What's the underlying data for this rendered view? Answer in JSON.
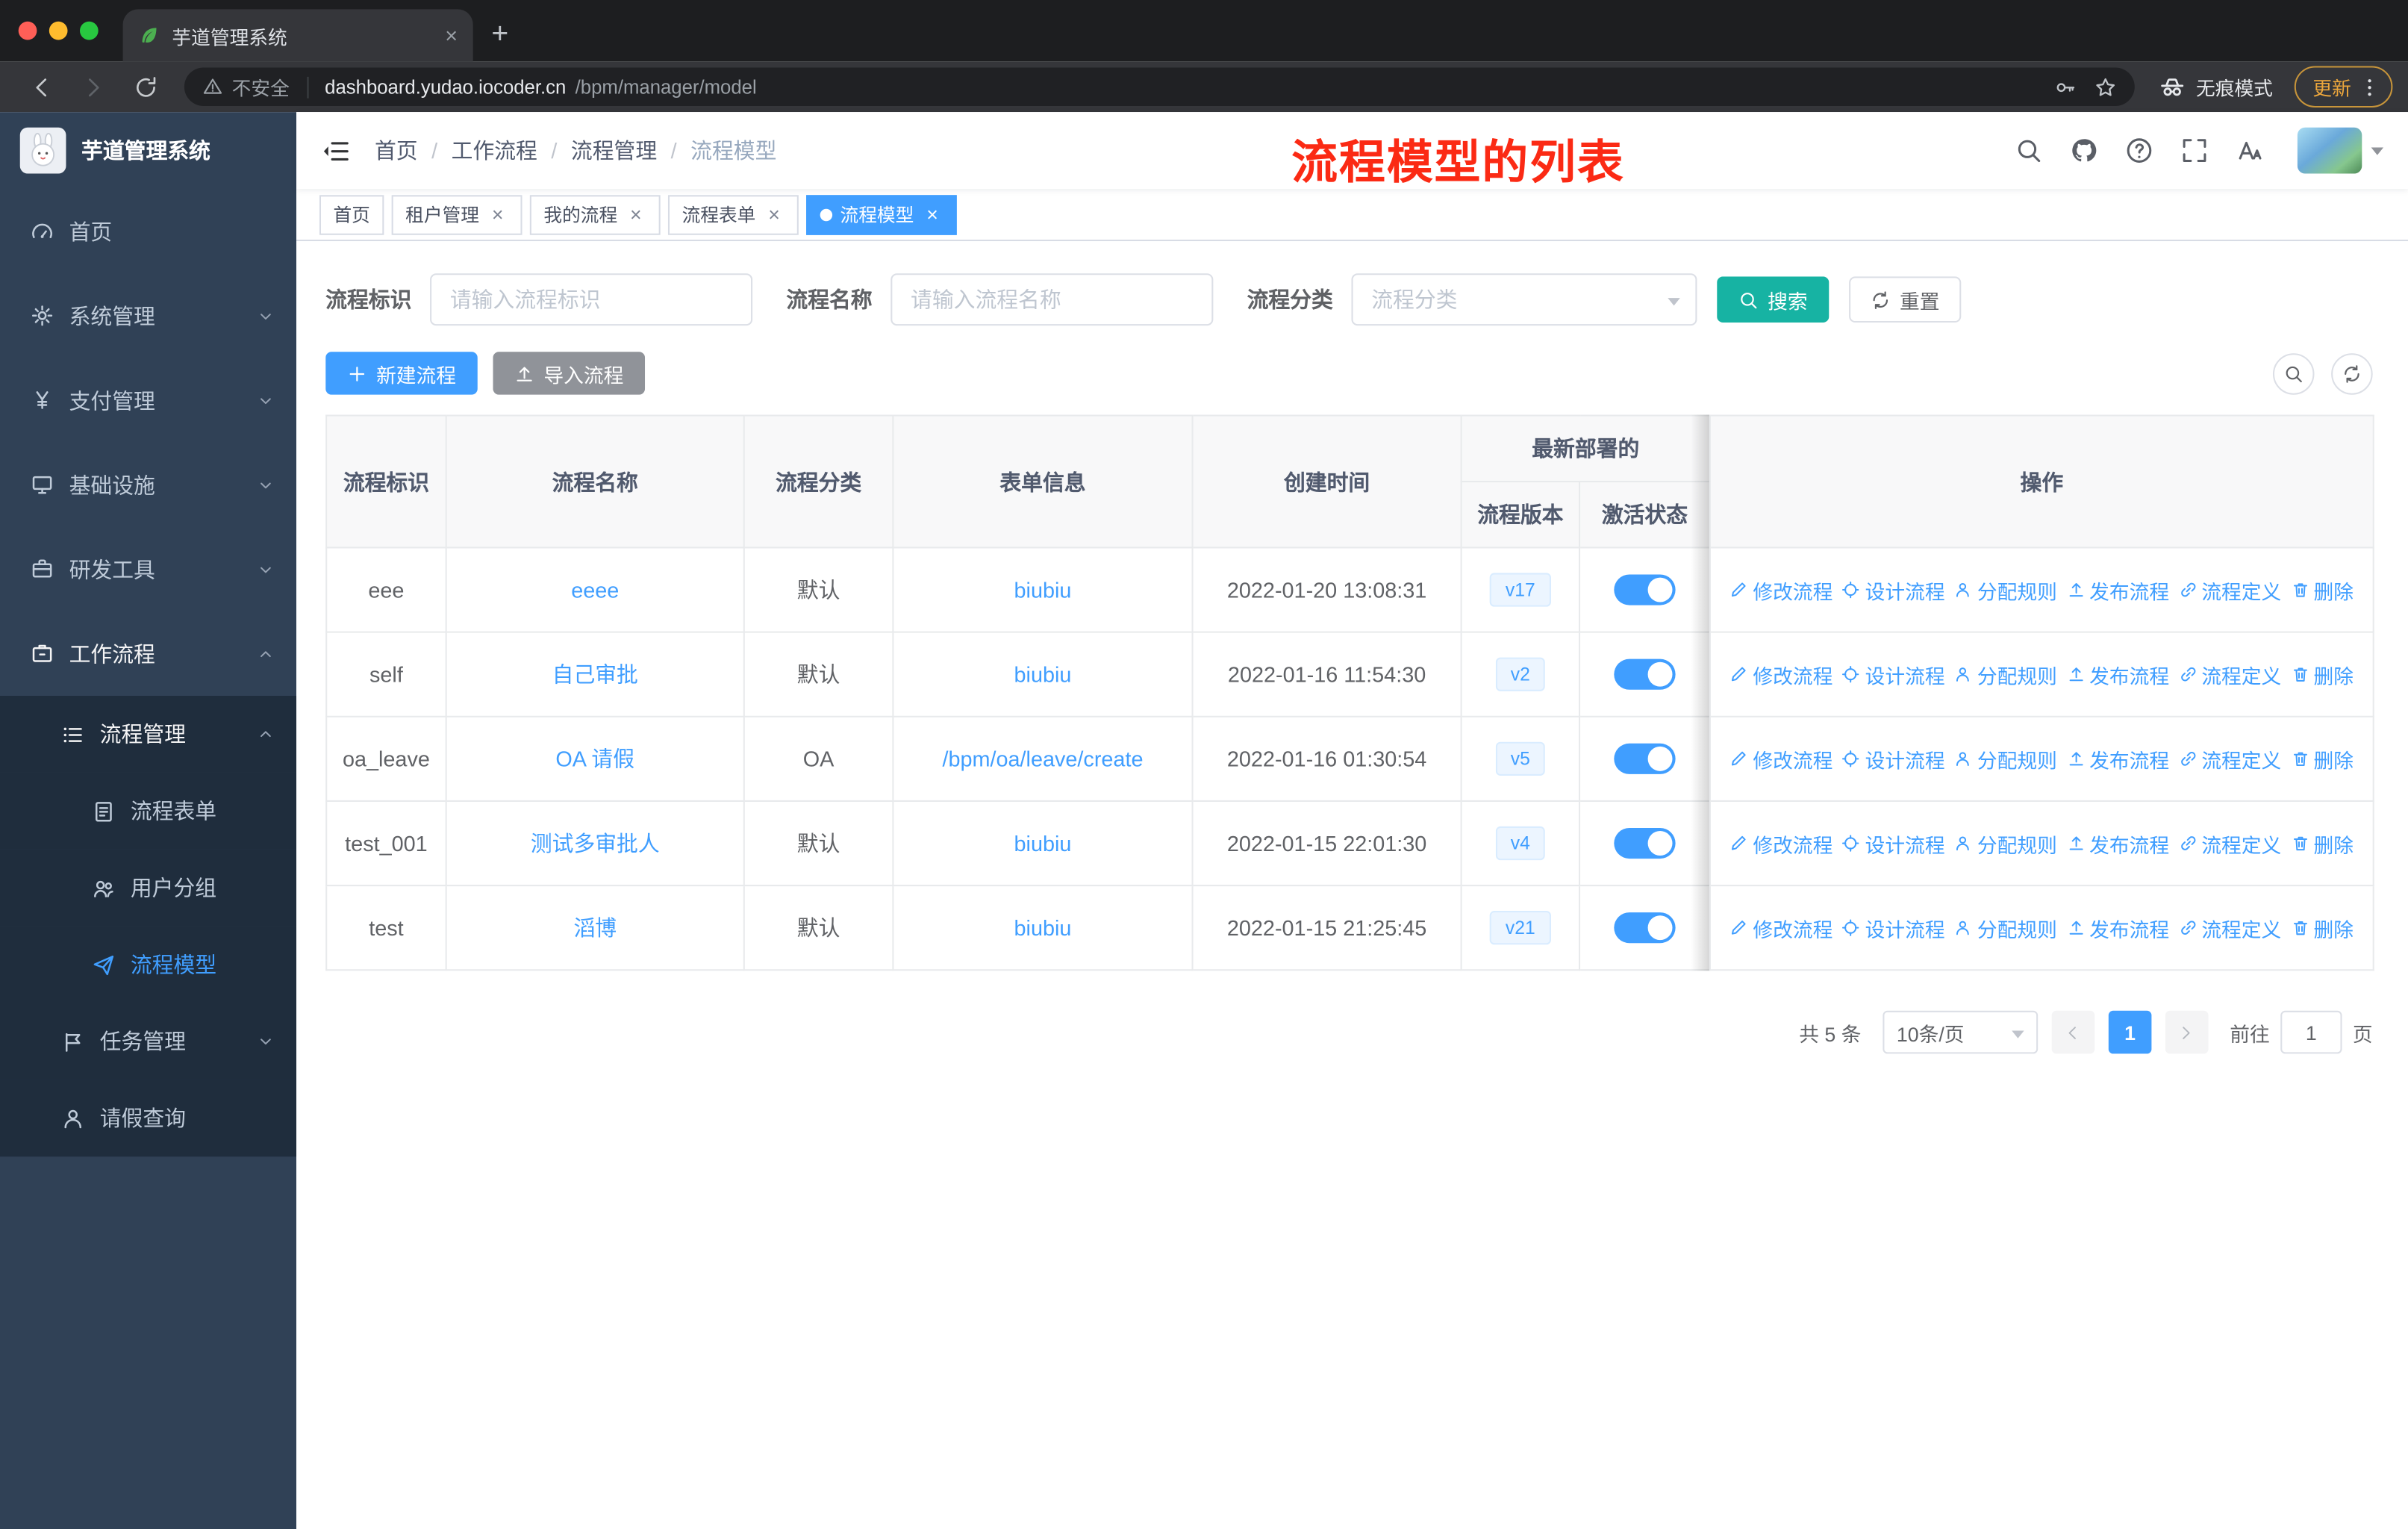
{
  "browser": {
    "tab_title": "芋道管理系统",
    "security_label": "不安全",
    "url_host": "dashboard.yudao.iocoder.cn",
    "url_path": "/bpm/manager/model",
    "incognito_label": "无痕模式",
    "update_label": "更新"
  },
  "sidebar": {
    "logo_title": "芋道管理系统",
    "items": [
      {
        "key": "home",
        "label": "首页",
        "icon": "dashboard-icon",
        "level": 1,
        "expandable": false,
        "expanded": false,
        "active": false
      },
      {
        "key": "system-management",
        "label": "系统管理",
        "icon": "gear-icon",
        "level": 1,
        "expandable": true,
        "expanded": false,
        "active": false
      },
      {
        "key": "payment-management",
        "label": "支付管理",
        "icon": "yen-icon",
        "level": 1,
        "expandable": true,
        "expanded": false,
        "active": false
      },
      {
        "key": "infrastructure",
        "label": "基础设施",
        "icon": "infra-icon",
        "level": 1,
        "expandable": true,
        "expanded": false,
        "active": false
      },
      {
        "key": "dev-tools",
        "label": "研发工具",
        "icon": "tools-icon",
        "level": 1,
        "expandable": true,
        "expanded": false,
        "active": false
      },
      {
        "key": "workflow",
        "label": "工作流程",
        "icon": "workflow-icon",
        "level": 1,
        "expandable": true,
        "expanded": true,
        "active": false
      },
      {
        "key": "process-management",
        "label": "流程管理",
        "icon": "list-icon",
        "level": 2,
        "expandable": true,
        "expanded": true,
        "active": false
      },
      {
        "key": "process-form",
        "label": "流程表单",
        "icon": "form-icon",
        "level": 3,
        "expandable": false,
        "expanded": false,
        "active": false
      },
      {
        "key": "user-group",
        "label": "用户分组",
        "icon": "group-icon",
        "level": 3,
        "expandable": false,
        "expanded": false,
        "active": false
      },
      {
        "key": "process-model",
        "label": "流程模型",
        "icon": "model-icon",
        "level": 3,
        "expandable": false,
        "expanded": false,
        "active": true
      },
      {
        "key": "task-management",
        "label": "任务管理",
        "icon": "task-icon",
        "level": 2,
        "expandable": true,
        "expanded": false,
        "active": false
      },
      {
        "key": "leave-query",
        "label": "请假查询",
        "icon": "person-icon",
        "level": 2,
        "expandable": false,
        "expanded": false,
        "active": false
      }
    ]
  },
  "header": {
    "breadcrumb": [
      "首页",
      "工作流程",
      "流程管理",
      "流程模型"
    ],
    "annotation": "流程模型的列表"
  },
  "tags": [
    {
      "label": "首页",
      "closable": false,
      "active": false
    },
    {
      "label": "租户管理",
      "closable": true,
      "active": false
    },
    {
      "label": "我的流程",
      "closable": true,
      "active": false
    },
    {
      "label": "流程表单",
      "closable": true,
      "active": false
    },
    {
      "label": "流程模型",
      "closable": true,
      "active": true
    }
  ],
  "filters": {
    "id_label": "流程标识",
    "id_placeholder": "请输入流程标识",
    "name_label": "流程名称",
    "name_placeholder": "请输入流程名称",
    "category_label": "流程分类",
    "category_placeholder": "流程分类",
    "search_label": "搜索",
    "reset_label": "重置"
  },
  "toolbar": {
    "create_label": "新建流程",
    "import_label": "导入流程"
  },
  "table": {
    "columns": {
      "id": "流程标识",
      "name": "流程名称",
      "category": "流程分类",
      "form": "表单信息",
      "created": "创建时间",
      "group": "最新部署的",
      "version": "流程版本",
      "status": "激活状态",
      "ops": "操作"
    },
    "ops": [
      {
        "icon": "edit-icon",
        "label": "修改流程"
      },
      {
        "icon": "design-icon",
        "label": "设计流程"
      },
      {
        "icon": "assign-icon",
        "label": "分配规则"
      },
      {
        "icon": "publish-icon",
        "label": "发布流程"
      },
      {
        "icon": "definition-icon",
        "label": "流程定义"
      },
      {
        "icon": "delete-icon",
        "label": "删除"
      }
    ],
    "rows": [
      {
        "id": "eee",
        "name": "eeee",
        "category": "默认",
        "form": "biubiu",
        "created": "2022-01-20 13:08:31",
        "version": "v17",
        "active": true
      },
      {
        "id": "self",
        "name": "自己审批",
        "category": "默认",
        "form": "biubiu",
        "created": "2022-01-16 11:54:30",
        "version": "v2",
        "active": true
      },
      {
        "id": "oa_leave",
        "name": "OA 请假",
        "category": "OA",
        "form": "/bpm/oa/leave/create",
        "created": "2022-01-16 01:30:54",
        "version": "v5",
        "active": true
      },
      {
        "id": "test_001",
        "name": "测试多审批人",
        "category": "默认",
        "form": "biubiu",
        "created": "2022-01-15 22:01:30",
        "version": "v4",
        "active": true
      },
      {
        "id": "test",
        "name": "滔博",
        "category": "默认",
        "form": "biubiu",
        "created": "2022-01-15 21:25:45",
        "version": "v21",
        "active": true
      }
    ]
  },
  "pagination": {
    "total_label": "共 5 条",
    "page_size": "10条/页",
    "current_page": "1",
    "goto_label": "前往",
    "page_unit": "页",
    "goto_value": "1"
  }
}
